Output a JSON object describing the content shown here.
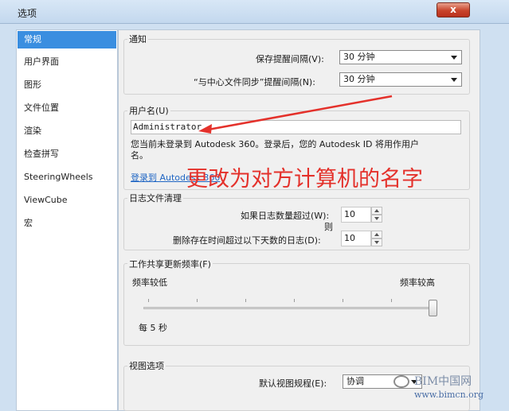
{
  "window": {
    "title": "选项",
    "close_label": "x"
  },
  "sidebar": {
    "items": [
      {
        "label": "常规",
        "active": true
      },
      {
        "label": "用户界面"
      },
      {
        "label": "图形"
      },
      {
        "label": "文件位置"
      },
      {
        "label": "渲染"
      },
      {
        "label": "检查拼写"
      },
      {
        "label": "SteeringWheels"
      },
      {
        "label": "ViewCube"
      },
      {
        "label": "宏"
      }
    ]
  },
  "notifications": {
    "title": "通知",
    "save_reminder_label": "保存提醒间隔(V):",
    "save_reminder_value": "30 分钟",
    "sync_reminder_label": "“与中心文件同步”提醒间隔(N):",
    "sync_reminder_value": "30 分钟"
  },
  "username": {
    "title": "用户名(U)",
    "value": "Administrator",
    "info_line1": "您当前未登录到 Autodesk 360。登录后，您的 Autodesk ID 将用作用户",
    "info_line2": "名。",
    "login_link": "登录到 Autodesk 360",
    "annotation": "更改为对方计算机的名字"
  },
  "journal": {
    "title": "日志文件清理",
    "count_label": "如果日志数量超过(W):",
    "count_value": "10",
    "then_label": "则",
    "delete_label": "删除存在时间超过以下天数的日志(D):",
    "delete_value": "10"
  },
  "worksharing": {
    "title": "工作共享更新频率(F)",
    "low_label": "频率较低",
    "high_label": "频率较高",
    "interval_text": "每 5 秒",
    "slider_level": 1.0
  },
  "view_options": {
    "title": "视图选项",
    "discipline_label": "默认视图规程(E):",
    "discipline_value": "协调"
  },
  "watermark": {
    "name": "BIM中国网",
    "url": "www.bimcn.org"
  },
  "colors": {
    "accent": "#3a8ee0",
    "annotation": "#e4312b",
    "link": "#2066c4"
  }
}
